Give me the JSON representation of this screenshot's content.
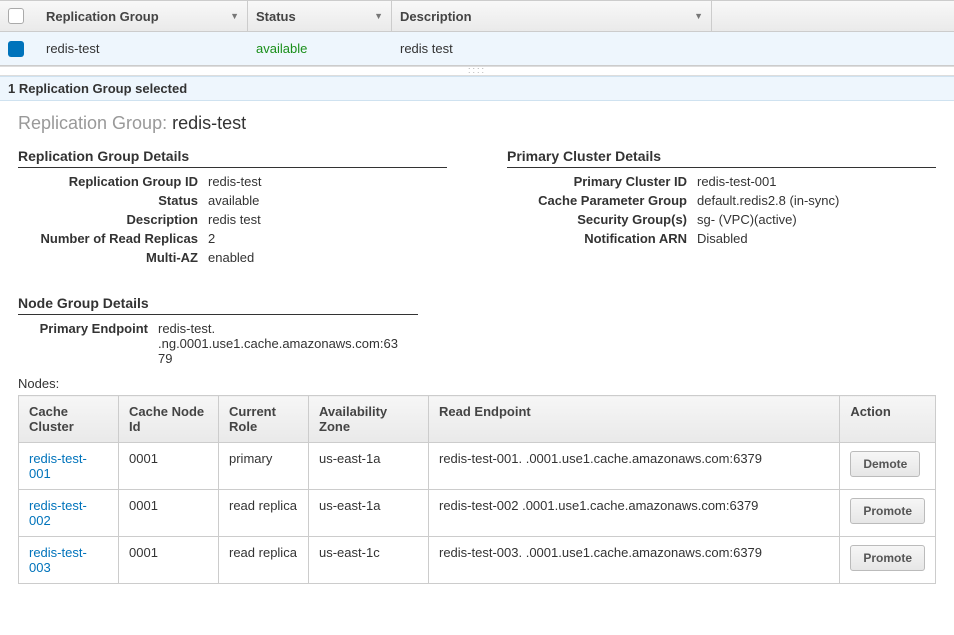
{
  "header": {
    "cols": {
      "rg": "Replication Group",
      "status": "Status",
      "desc": "Description"
    }
  },
  "row": {
    "rg": "redis-test",
    "status": "available",
    "desc": "redis test"
  },
  "selection_bar": "1 Replication Group selected",
  "title_prefix": "Replication Group: ",
  "title_value": "redis-test",
  "rg_details": {
    "heading": "Replication Group Details",
    "id_k": "Replication Group ID",
    "id_v": "redis-test",
    "status_k": "Status",
    "status_v": "available",
    "desc_k": "Description",
    "desc_v": "redis test",
    "replicas_k": "Number of Read Replicas",
    "replicas_v": "2",
    "maz_k": "Multi-AZ",
    "maz_v": "enabled"
  },
  "pc_details": {
    "heading": "Primary Cluster Details",
    "pid_k": "Primary Cluster ID",
    "pid_v": "redis-test-001",
    "pg_k": "Cache Parameter Group",
    "pg_v": "default.redis2.8 (in-sync)",
    "sg_k": "Security Group(s)",
    "sg_v": "sg-            (VPC)(active)",
    "arn_k": "Notification ARN",
    "arn_v": "Disabled"
  },
  "ng": {
    "heading": "Node Group Details",
    "pe_k": "Primary Endpoint",
    "pe_v": "redis-test.        .ng.0001.use1.cache.amazonaws.com:6379",
    "nodes_label": "Nodes:",
    "cols": {
      "cc": "Cache Cluster",
      "cn": "Cache Node Id",
      "role": "Current Role",
      "az": "Availability Zone",
      "re": "Read Endpoint",
      "action": "Action"
    },
    "rows": [
      {
        "cc": "redis-test-001",
        "cn": "0001",
        "role": "primary",
        "az": "us-east-1a",
        "re": "redis-test-001.        .0001.use1.cache.amazonaws.com:6379",
        "action": "Demote"
      },
      {
        "cc": "redis-test-002",
        "cn": "0001",
        "role": "read replica",
        "az": "us-east-1a",
        "re": "redis-test-002        .0001.use1.cache.amazonaws.com:6379",
        "action": "Promote"
      },
      {
        "cc": "redis-test-003",
        "cn": "0001",
        "role": "read replica",
        "az": "us-east-1c",
        "re": "redis-test-003.        .0001.use1.cache.amazonaws.com:6379",
        "action": "Promote"
      }
    ]
  }
}
